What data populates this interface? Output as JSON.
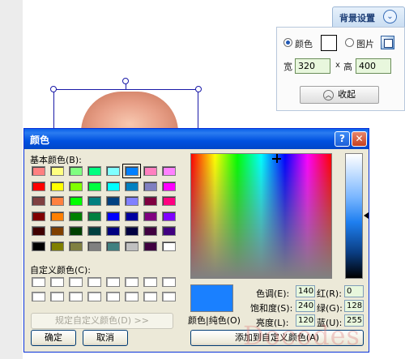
{
  "bg_panel": {
    "title": "背景设置",
    "toggle_icon": "chevron-down-circle-icon",
    "color_option": "颜色",
    "image_option": "图片",
    "width_label": "宽",
    "width_value": "320",
    "times": "x",
    "height_label": "高",
    "height_value": "400",
    "collapse_label": "收起",
    "collapse_icon": "chevron-up-circle-icon",
    "color_swatch": "#ffffff"
  },
  "color_dialog": {
    "title": "颜色",
    "help_label": "?",
    "close_label": "✕",
    "basic_colors_label": "基本颜色(B):",
    "custom_colors_label": "自定义颜色(C):",
    "define_custom_label": "规定自定义颜色(D) >>",
    "ok_label": "确定",
    "cancel_label": "取消",
    "preview_label": "颜色|纯色(O)",
    "add_custom_label": "添加到自定义颜色(A)",
    "fields": {
      "hue_label": "色调(E):",
      "hue": "140",
      "sat_label": "饱和度(S):",
      "sat": "240",
      "lum_label": "亮度(L):",
      "lum": "120",
      "red_label": "红(R):",
      "red": "0",
      "green_label": "绿(G):",
      "green": "128",
      "blue_label": "蓝(U):",
      "blue": "255"
    },
    "basic_colors": [
      [
        "#ff8080",
        "#ffff80",
        "#80ff80",
        "#00ff80",
        "#80ffff",
        "#0080ff",
        "#ff80c0",
        "#ff80ff"
      ],
      [
        "#ff0000",
        "#ffff00",
        "#80ff00",
        "#00ff40",
        "#00ffff",
        "#0080c0",
        "#8080c0",
        "#ff00ff"
      ],
      [
        "#804040",
        "#ff8040",
        "#00ff00",
        "#008080",
        "#004080",
        "#8080ff",
        "#800040",
        "#ff0080"
      ],
      [
        "#800000",
        "#ff8000",
        "#008000",
        "#008040",
        "#0000ff",
        "#0000a0",
        "#800080",
        "#8000ff"
      ],
      [
        "#400000",
        "#804000",
        "#004000",
        "#004040",
        "#000080",
        "#000040",
        "#400040",
        "#400080"
      ],
      [
        "#000000",
        "#808000",
        "#808040",
        "#808080",
        "#408080",
        "#c0c0c0",
        "#400040",
        "#ffffff"
      ]
    ],
    "selected_color": "#0080ff"
  },
  "watermark": "Docodes"
}
